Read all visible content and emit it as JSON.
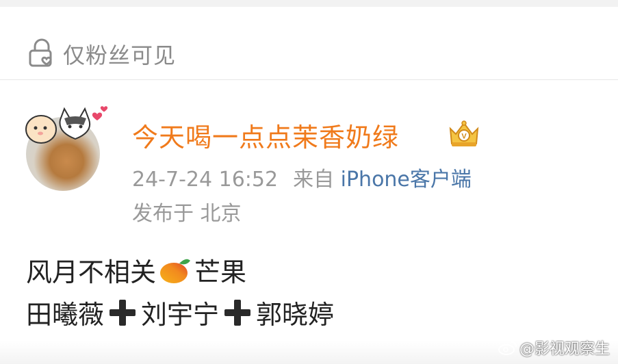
{
  "visibility": {
    "label": "仅粉丝可见",
    "icon": "lock-heart-icon"
  },
  "post": {
    "username": "今天喝一点点茉香奶绿",
    "badge_icon": "vip-crown-icon",
    "time": "24-7-24 16:52",
    "from_label": "来自",
    "client": "iPhone客户端",
    "location": "发布于 北京",
    "body": {
      "line1_text": "风月不相关",
      "line1_emoji": "mango-icon",
      "line1_suffix": "芒果",
      "line2_names": [
        "田曦薇",
        "刘宇宁",
        "郭晓婷"
      ],
      "line2_separator_icon": "heavy-plus-icon"
    }
  },
  "watermark": {
    "text": "@影视观察生",
    "icon": "weibo-logo-icon"
  },
  "colors": {
    "username": "#f07a1b",
    "meta": "#999999",
    "client_link": "#4a76a8",
    "body_text": "#222222"
  }
}
